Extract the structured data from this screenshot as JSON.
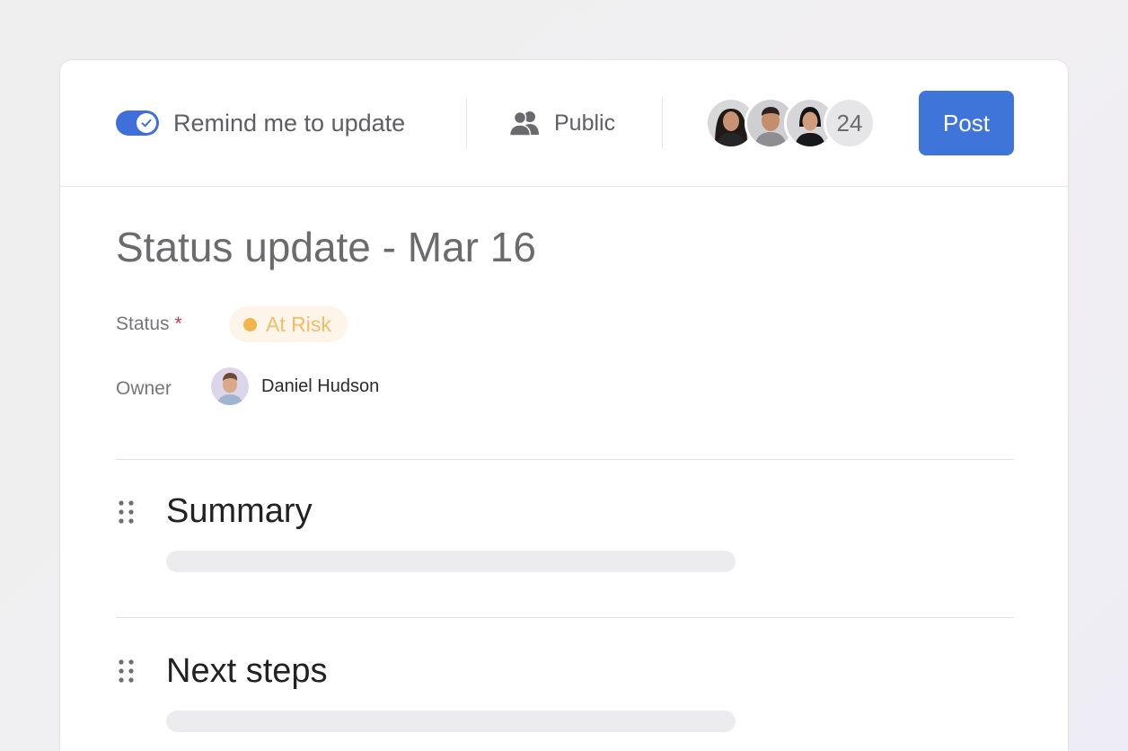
{
  "header": {
    "remind_toggle": {
      "label": "Remind me to update",
      "on": true
    },
    "visibility": {
      "label": "Public",
      "icon": "people-icon"
    },
    "collaborators": {
      "extra_count": "24"
    },
    "post_button": {
      "label": "Post"
    }
  },
  "update": {
    "title": "Status update - Mar 16",
    "status": {
      "label": "Status",
      "required_mark": "*",
      "value": "At Risk",
      "color": "#f1b54a"
    },
    "owner": {
      "label": "Owner",
      "name": "Daniel Hudson"
    }
  },
  "sections": [
    {
      "title": "Summary"
    },
    {
      "title": "Next steps"
    }
  ],
  "colors": {
    "accent": "#3f74d8",
    "at_risk": "#f1b54a",
    "required": "#c4384a"
  }
}
